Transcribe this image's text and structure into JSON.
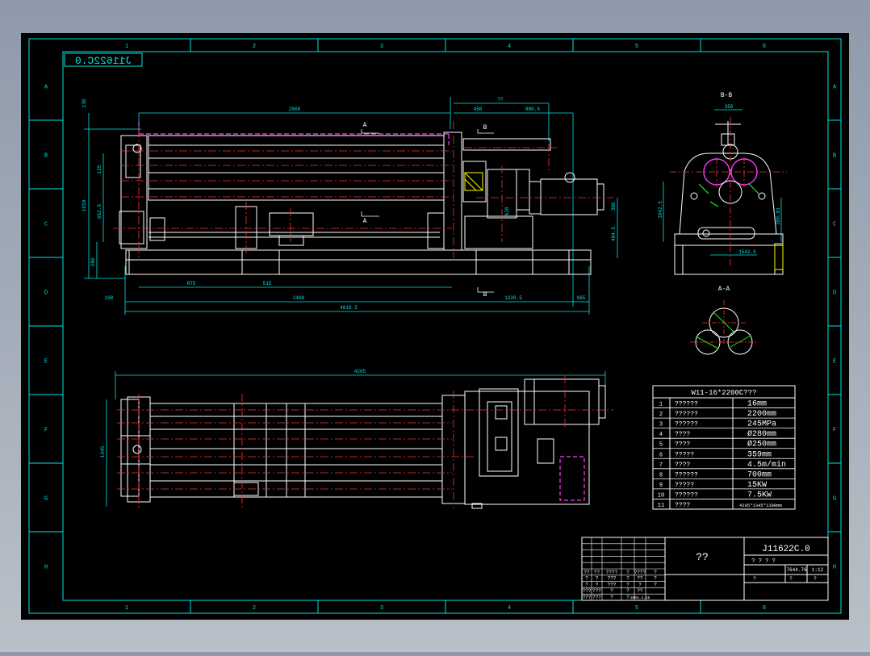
{
  "window": {
    "background": "#000000",
    "frame_color": "#00e5e5"
  },
  "colors": {
    "frame": "#00e5e5",
    "geometry": "#ffffff",
    "centerline": "#ff3030",
    "hidden": "#ff3cff",
    "dimension": "#00e5e5",
    "accent": "#ffff00",
    "green": "#00ff00"
  },
  "grid": {
    "columns": [
      "1",
      "2",
      "3",
      "4",
      "5",
      "6"
    ],
    "rows": [
      "A",
      "B",
      "C",
      "D",
      "E",
      "F",
      "G",
      "H"
    ]
  },
  "drawing": {
    "mirrored_code": "J11622C.0",
    "view_labels": {
      "b_b": "B-B",
      "a_a": "A-A"
    },
    "section_marks": [
      "A",
      "A",
      "B",
      "B"
    ],
    "dims_front": {
      "top_length": "2900",
      "top_right_1": "450",
      "top_right_2": "880.5",
      "top_right_3": "??",
      "bottom_1": "875",
      "bottom_2": "515",
      "bottom_3": "2400",
      "bottom_4": "1320.5",
      "overall": "4810.5",
      "left_offset": "100",
      "right_offset": "965",
      "left_v1": "130",
      "left_v2": "125",
      "left_v3": "1010",
      "left_v4": "652.5",
      "left_v5": "280",
      "right_v1": "380",
      "right_v2": "484.5",
      "mid_v": "528"
    },
    "dims_side": {
      "top": "350",
      "left_v": "1042.5",
      "right_v": "280.81",
      "base": "1542.5"
    },
    "dims_plan": {
      "overall": "4265",
      "left_v": "1345"
    }
  },
  "spec_table": {
    "title": "W11-16*2200C???",
    "rows": [
      {
        "no": "1",
        "name": "??????",
        "value": "16mm"
      },
      {
        "no": "2",
        "name": "??????",
        "value": "2200mm"
      },
      {
        "no": "3",
        "name": "??????",
        "value": "245MPa"
      },
      {
        "no": "4",
        "name": "????",
        "value": "Ø280mm"
      },
      {
        "no": "5",
        "name": "????",
        "value": "Ø250mm"
      },
      {
        "no": "6",
        "name": "?????",
        "value": "359mm"
      },
      {
        "no": "7",
        "name": "????",
        "value": "4.5m/min"
      },
      {
        "no": "8",
        "name": "??????",
        "value": "700mm"
      },
      {
        "no": "9",
        "name": "?????",
        "value": "15KW"
      },
      {
        "no": "10",
        "name": "??????",
        "value": "7.5KW"
      },
      {
        "no": "11",
        "name": "????",
        "value": "4265*1345*1390mm"
      }
    ]
  },
  "title_block": {
    "drawing_no": "J11622C.0",
    "name": "??",
    "stage_label": "? ? ? ?",
    "weight": "7644.76",
    "scale": "1:12",
    "sheet_cells": [
      "?",
      "?",
      "?"
    ],
    "left_cells": [
      [
        "??",
        "??",
        "????",
        "?",
        "????",
        "?"
      ],
      [
        "?",
        "?",
        "???",
        "?",
        "??",
        "?"
      ],
      [
        "?",
        "?",
        "???",
        "?",
        "?",
        "?"
      ],
      [
        "???",
        "???",
        "?",
        "?",
        "??",
        ""
      ],
      [
        "???",
        "???",
        "?",
        "?",
        "2004.4.26",
        ""
      ]
    ]
  }
}
